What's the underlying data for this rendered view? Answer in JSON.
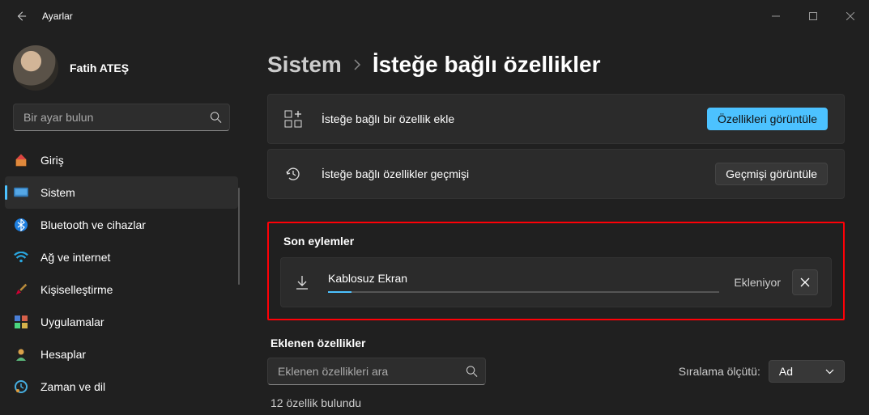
{
  "titlebar": {
    "title": "Ayarlar"
  },
  "profile": {
    "name": "Fatih ATEŞ"
  },
  "search": {
    "placeholder": "Bir ayar bulun"
  },
  "sidebar": {
    "items": [
      {
        "label": "Giriş"
      },
      {
        "label": "Sistem"
      },
      {
        "label": "Bluetooth ve cihazlar"
      },
      {
        "label": "Ağ ve internet"
      },
      {
        "label": "Kişiselleştirme"
      },
      {
        "label": "Uygulamalar"
      },
      {
        "label": "Hesaplar"
      },
      {
        "label": "Zaman ve dil"
      }
    ]
  },
  "breadcrumb": {
    "root": "Sistem",
    "leaf": "İsteğe bağlı özellikler"
  },
  "cards": {
    "add": {
      "label": "İsteğe bağlı bir özellik ekle",
      "button": "Özellikleri görüntüle"
    },
    "history": {
      "label": "İsteğe bağlı özellikler geçmişi",
      "button": "Geçmişi görüntüle"
    }
  },
  "recent": {
    "title": "Son eylemler",
    "item": {
      "name": "Kablosuz Ekran",
      "status": "Ekleniyor"
    }
  },
  "installed": {
    "title": "Eklenen özellikler",
    "search_placeholder": "Eklenen özellikleri ara",
    "sort_label": "Sıralama ölçütü:",
    "sort_value": "Ad",
    "found": "12 özellik bulundu"
  }
}
